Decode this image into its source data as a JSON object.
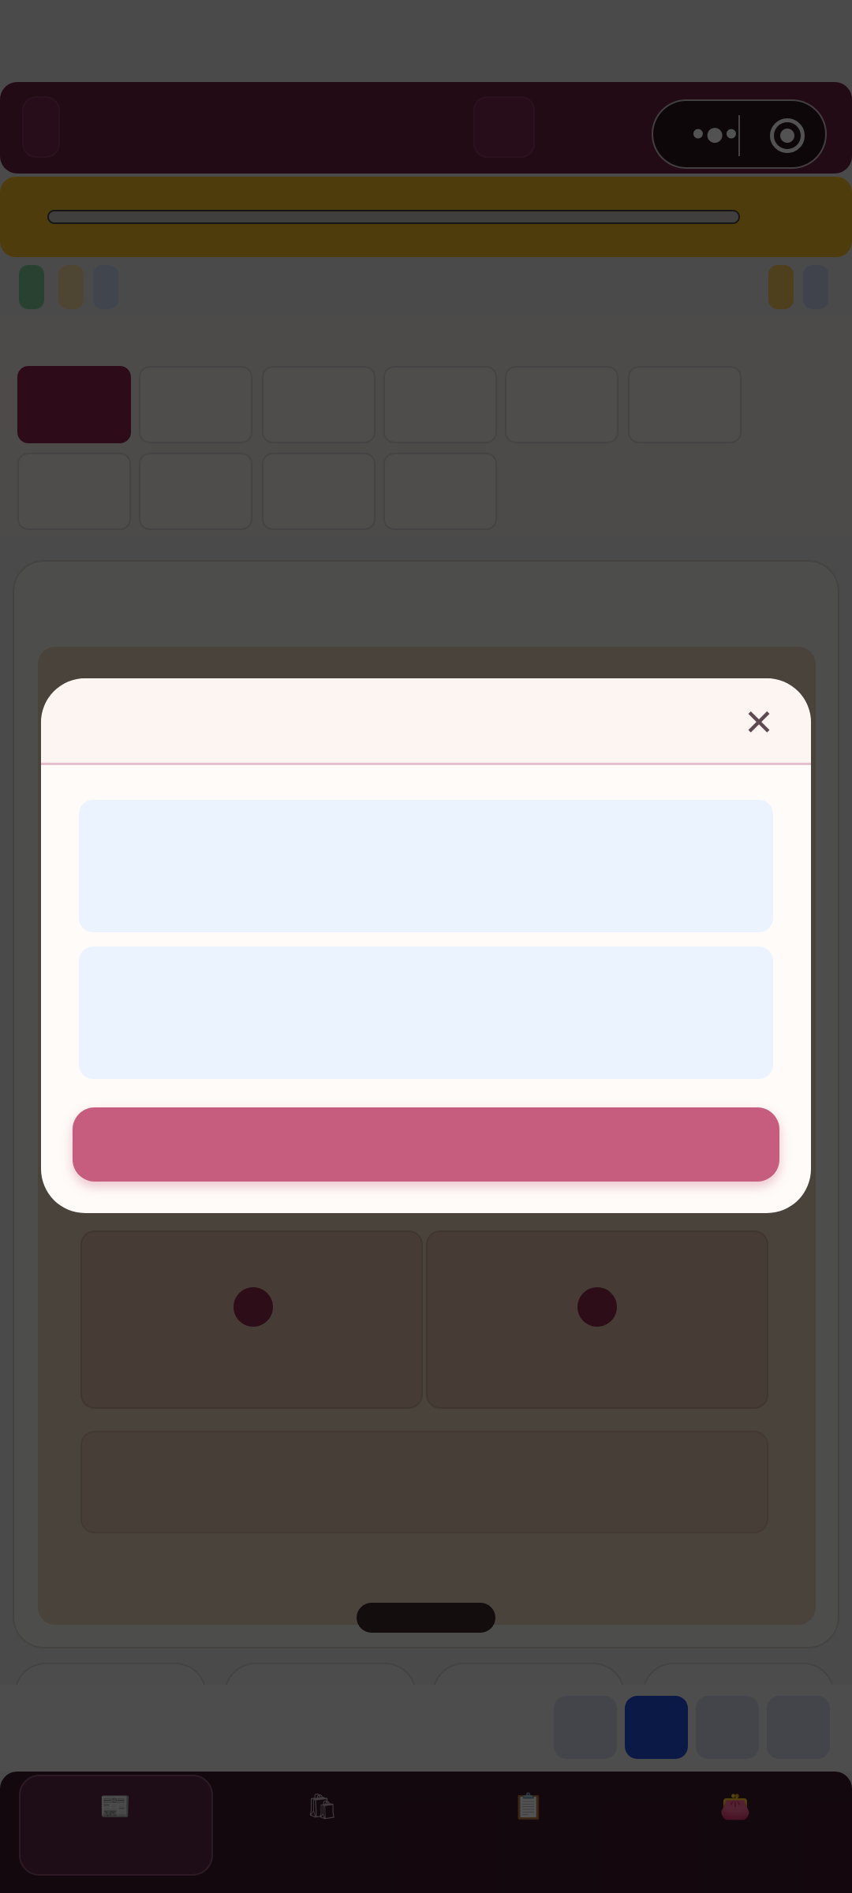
{
  "capsule": {
    "more_glyph": "•●•",
    "more_icon": "more-dots-icon",
    "target_icon": "target-icon"
  },
  "nav": {
    "items": [
      {
        "icon": "📰",
        "icon_name": "store-icon"
      },
      {
        "icon": "🛍",
        "icon_name": "bag-icon"
      },
      {
        "icon": "📋",
        "icon_name": "clipboard-icon"
      },
      {
        "icon": "👛",
        "icon_name": "wallet-icon"
      }
    ]
  },
  "modal": {
    "close_glyph": "✕",
    "field_1": "",
    "field_2": "",
    "primary_label": ""
  },
  "colors": {
    "brand": "#8c2550",
    "primary_button": "#c75d7e",
    "field_bg": "#eaf3ff",
    "overlay": "rgba(0,0,0,0.68)"
  }
}
